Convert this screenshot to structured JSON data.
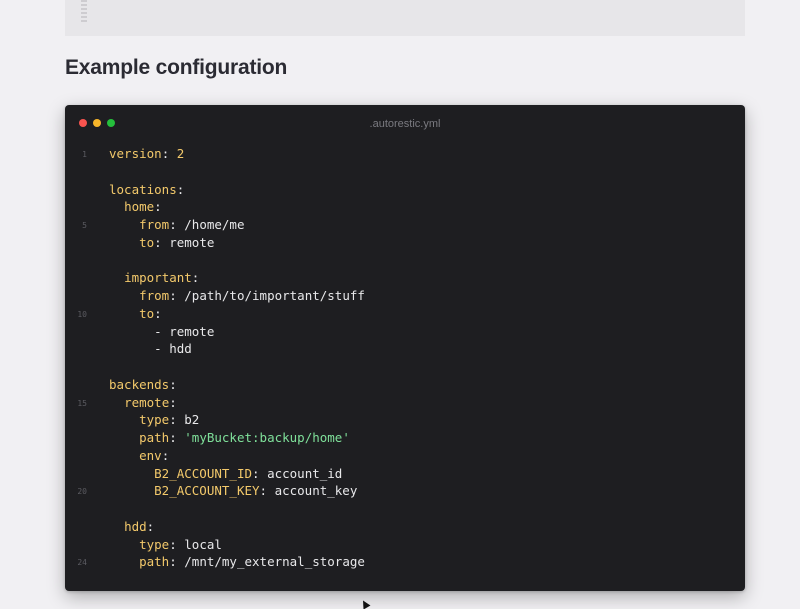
{
  "page": {
    "heading": "Example configuration"
  },
  "editor": {
    "filename": ".autorestic.yml",
    "colors": {
      "background": "#1e1e21",
      "key": "#f3c96b",
      "string": "#7fe09a",
      "text": "#e8e8ea",
      "line_number": "#5b5b61",
      "dot_red": "#f9544f",
      "dot_yellow": "#f7b52a",
      "dot_green": "#25bf3c"
    },
    "line_numbers": [
      "1",
      "5",
      "10",
      "15",
      "20",
      "24"
    ],
    "lines": [
      {
        "ln": "1",
        "indent": "",
        "key": "version",
        "sep": ": ",
        "value": "2",
        "vtype": "num"
      },
      {
        "ln": "",
        "indent": "",
        "key": "",
        "sep": "",
        "value": "",
        "vtype": "plain"
      },
      {
        "ln": "",
        "indent": "",
        "key": "locations",
        "sep": ":",
        "value": "",
        "vtype": "plain"
      },
      {
        "ln": "",
        "indent": "  ",
        "key": "home",
        "sep": ":",
        "value": "",
        "vtype": "plain"
      },
      {
        "ln": "5",
        "indent": "    ",
        "key": "from",
        "sep": ": ",
        "value": "/home/me",
        "vtype": "plain"
      },
      {
        "ln": "",
        "indent": "    ",
        "key": "to",
        "sep": ": ",
        "value": "remote",
        "vtype": "plain"
      },
      {
        "ln": "",
        "indent": "",
        "key": "",
        "sep": "",
        "value": "",
        "vtype": "plain"
      },
      {
        "ln": "",
        "indent": "  ",
        "key": "important",
        "sep": ":",
        "value": "",
        "vtype": "plain"
      },
      {
        "ln": "",
        "indent": "    ",
        "key": "from",
        "sep": ": ",
        "value": "/path/to/important/stuff",
        "vtype": "plain"
      },
      {
        "ln": "10",
        "indent": "    ",
        "key": "to",
        "sep": ":",
        "value": "",
        "vtype": "plain"
      },
      {
        "ln": "",
        "indent": "      ",
        "key": "",
        "sep": "",
        "value": "- remote",
        "vtype": "plain"
      },
      {
        "ln": "",
        "indent": "      ",
        "key": "",
        "sep": "",
        "value": "- hdd",
        "vtype": "plain"
      },
      {
        "ln": "",
        "indent": "",
        "key": "",
        "sep": "",
        "value": "",
        "vtype": "plain"
      },
      {
        "ln": "",
        "indent": "",
        "key": "backends",
        "sep": ":",
        "value": "",
        "vtype": "plain"
      },
      {
        "ln": "15",
        "indent": "  ",
        "key": "remote",
        "sep": ":",
        "value": "",
        "vtype": "plain"
      },
      {
        "ln": "",
        "indent": "    ",
        "key": "type",
        "sep": ": ",
        "value": "b2",
        "vtype": "plain"
      },
      {
        "ln": "",
        "indent": "    ",
        "key": "path",
        "sep": ": ",
        "value": "'myBucket:backup/home'",
        "vtype": "str"
      },
      {
        "ln": "",
        "indent": "    ",
        "key": "env",
        "sep": ":",
        "value": "",
        "vtype": "plain"
      },
      {
        "ln": "",
        "indent": "      ",
        "key": "B2_ACCOUNT_ID",
        "sep": ": ",
        "value": "account_id",
        "vtype": "plain"
      },
      {
        "ln": "20",
        "indent": "      ",
        "key": "B2_ACCOUNT_KEY",
        "sep": ": ",
        "value": "account_key",
        "vtype": "plain"
      },
      {
        "ln": "",
        "indent": "",
        "key": "",
        "sep": "",
        "value": "",
        "vtype": "plain"
      },
      {
        "ln": "",
        "indent": "  ",
        "key": "hdd",
        "sep": ":",
        "value": "",
        "vtype": "plain"
      },
      {
        "ln": "",
        "indent": "    ",
        "key": "type",
        "sep": ": ",
        "value": "local",
        "vtype": "plain"
      },
      {
        "ln": "24",
        "indent": "    ",
        "key": "path",
        "sep": ": ",
        "value": "/mnt/my_external_storage",
        "vtype": "plain"
      }
    ]
  }
}
